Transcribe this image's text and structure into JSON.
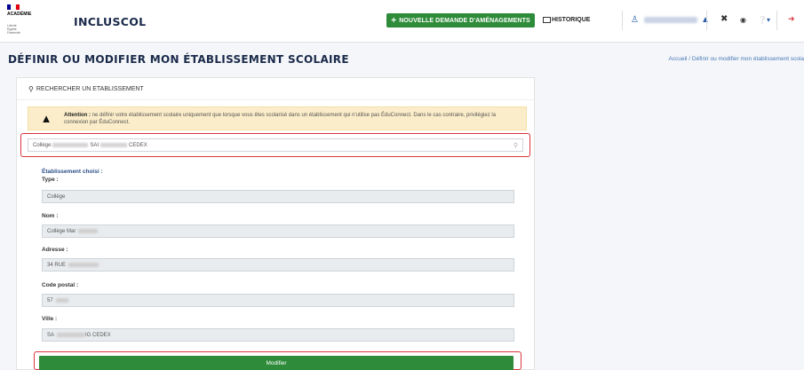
{
  "header": {
    "logo_text": "ACADÉMIE",
    "logo_sub": [
      "Liberté",
      "Égalité",
      "Fraternité"
    ],
    "flag_colors": [
      "#000091",
      "#ffffff",
      "#e1000f"
    ],
    "app_name": "INCLUSCOL",
    "new_request_label": "NOUVELLE DEMANDE D'AMÉNAGEMENTS",
    "history_label": "HISTORIQUE",
    "icons": [
      "user-icon",
      "graduation-cap-icon",
      "expand-icon",
      "eye-icon",
      "help-icon",
      "logout-icon"
    ]
  },
  "page": {
    "title": "DÉFINIR OU MODIFIER MON ÉTABLISSEMENT SCOLAIRE",
    "breadcrumb": "Accueil / Définir ou modifier mon établissement scola"
  },
  "card": {
    "header": "RECHERCHER UN ETABLISSEMENT",
    "warning_title": "Attention :",
    "warning_text": "ne définir votre établissement scolaire uniquement que lorsque vous êtes scolarisé dans un établissement qui n'utilise pas ÉduConnect. Dans le cas contraire, privilégiez la connexion par ÉduConnect.",
    "search_value": {
      "p1": "Collège",
      "p2": "SAI",
      "p3": "CEDEX"
    },
    "chosen_label": "Établissement choisi :",
    "fields": {
      "type_label": "Type :",
      "type_value": "Collège",
      "nom_label": "Nom :",
      "nom_value": "Collège Mar",
      "adresse_label": "Adresse :",
      "adresse_value": "34 RUE",
      "cp_label": "Code postal :",
      "cp_value": "57",
      "ville_label": "Ville :",
      "ville_value_a": "SA",
      "ville_value_b": "IG CEDEX"
    },
    "submit_label": "Modifier"
  },
  "colors": {
    "accent_green": "#2e8b3a",
    "highlight_red": "#d9363e",
    "title_navy": "#1b2a4a",
    "warning_bg": "#fbedc9"
  }
}
